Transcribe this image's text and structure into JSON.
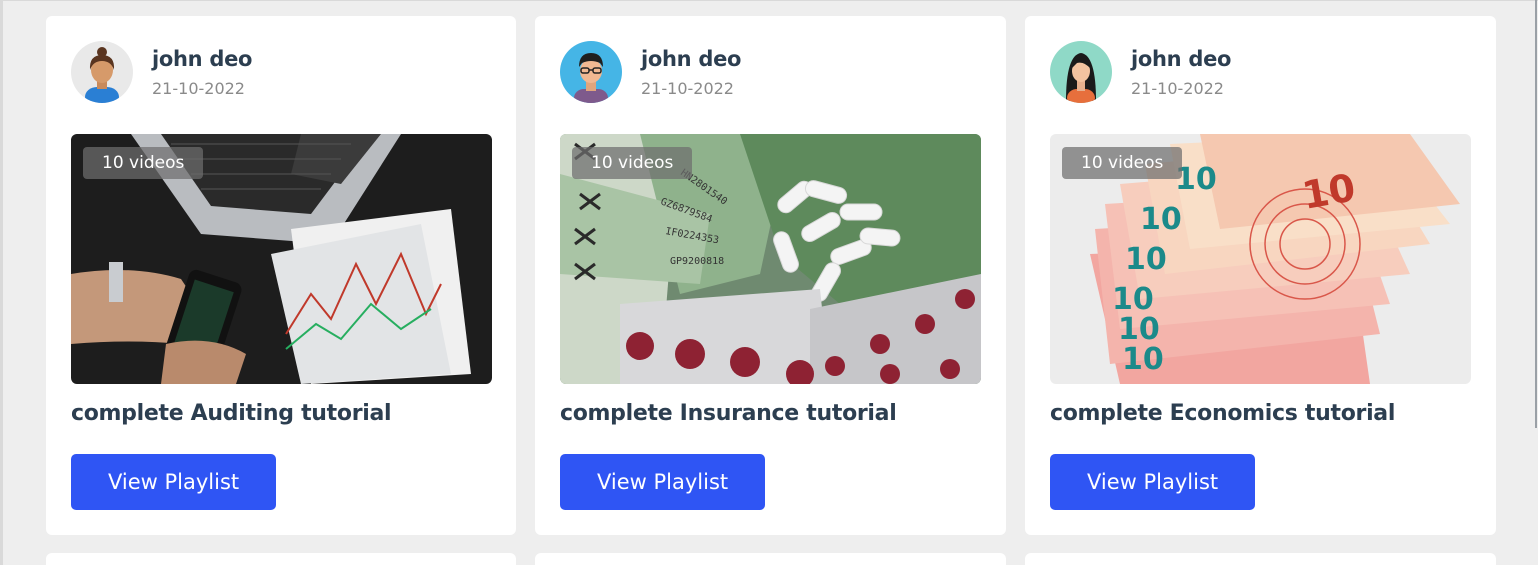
{
  "playlists": [
    {
      "author": "john deo",
      "date": "21-10-2022",
      "badge": "10 videos",
      "title": "complete Auditing tutorial",
      "button": "View Playlist",
      "avatar_icon": "female-avatar-icon",
      "thumbnail": "trading-laptop-phone-charts"
    },
    {
      "author": "john deo",
      "date": "21-10-2022",
      "badge": "10 videos",
      "title": "complete Insurance tutorial",
      "button": "View Playlist",
      "avatar_icon": "male-glasses-avatar-icon",
      "thumbnail": "banknotes-and-pills"
    },
    {
      "author": "john deo",
      "date": "21-10-2022",
      "badge": "10 videos",
      "title": "complete Economics tutorial",
      "button": "View Playlist",
      "avatar_icon": "female-long-hair-avatar-icon",
      "thumbnail": "euro-banknotes-fan"
    }
  ],
  "colors": {
    "background": "#eeeeee",
    "card": "#ffffff",
    "button": "#2f55f4",
    "heading_text": "#2c3e50",
    "muted_text": "#8a8a8a"
  }
}
